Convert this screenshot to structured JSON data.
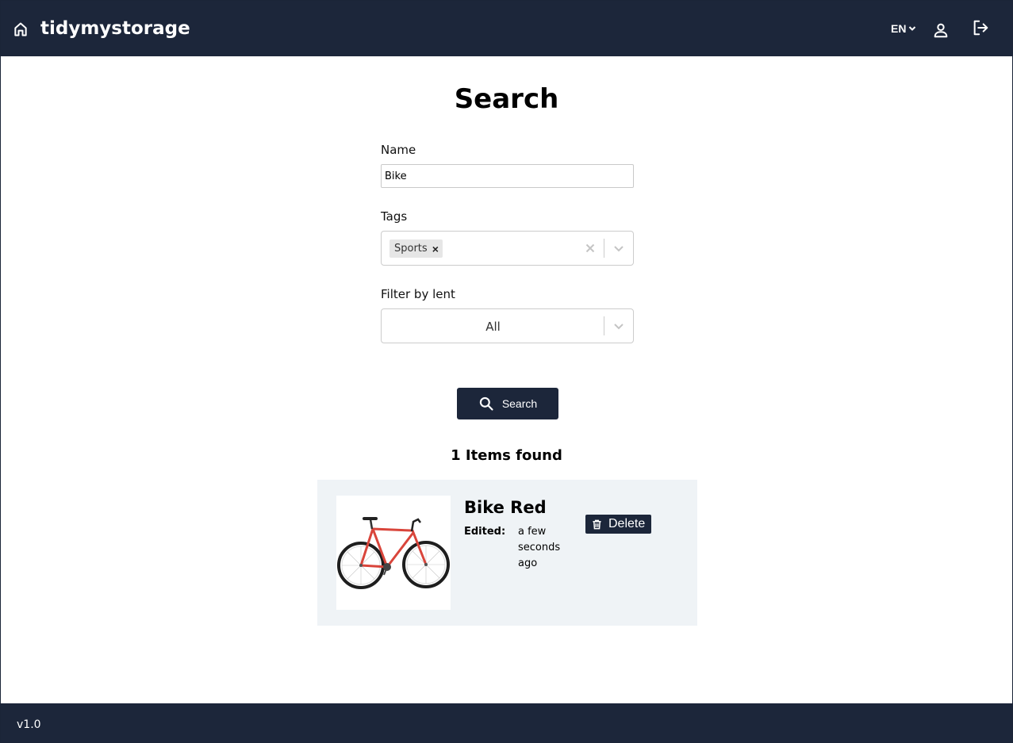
{
  "header": {
    "brand": "tidymystorage",
    "language": "EN",
    "icons": [
      "home-icon",
      "chevron-down-icon",
      "user-icon",
      "logout-icon"
    ]
  },
  "page": {
    "title": "Search"
  },
  "form": {
    "name_label": "Name",
    "name_value": "Bike",
    "tags_label": "Tags",
    "selected_tags": [
      "Sports"
    ],
    "lent_label": "Filter by lent",
    "lent_value": "All",
    "search_button": "Search"
  },
  "results": {
    "count_text": "1 Items found",
    "items": [
      {
        "name": "Bike Red",
        "edited_label": "Edited:",
        "edited_value": "a few seconds ago",
        "delete_label": "Delete"
      }
    ]
  },
  "footer": {
    "version": "v1.0"
  },
  "colors": {
    "navbar": "#1c263a",
    "card_background": "#eff3f6",
    "bike_frame": "#d9453b"
  }
}
